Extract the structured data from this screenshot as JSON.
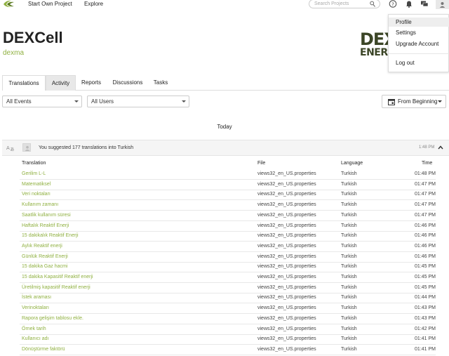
{
  "topbar": {
    "nav": [
      {
        "label": "Start Own Project"
      },
      {
        "label": "Explore"
      }
    ],
    "search_placeholder": "Search Projects"
  },
  "project": {
    "title": "DEXCell",
    "org": "dexma"
  },
  "brand": {
    "line1": "DEX",
    "line2": "ENERGY"
  },
  "account_menu": {
    "items": [
      {
        "label": "Profile"
      },
      {
        "label": "Settings"
      },
      {
        "label": "Upgrade Account"
      },
      {
        "label": "Log out"
      }
    ]
  },
  "tabs": [
    {
      "label": "Translations"
    },
    {
      "label": "Activity"
    },
    {
      "label": "Reports"
    },
    {
      "label": "Discussions"
    },
    {
      "label": "Tasks"
    }
  ],
  "filters": {
    "events": "All Events",
    "users": "All Users",
    "date": "From Beginning"
  },
  "day_label": "Today",
  "activity": {
    "summary": "You suggested 177 translations into Turkish",
    "time": "1:48 PM",
    "columns": {
      "translation": "Translation",
      "file": "File",
      "language": "Language",
      "time": "Time"
    },
    "rows": [
      {
        "translation": "Gerilim L-L",
        "file": "views32_en_US.properties",
        "language": "Turkish",
        "time": "01:48 PM"
      },
      {
        "translation": "Matematiksel",
        "file": "views32_en_US.properties",
        "language": "Turkish",
        "time": "01:47 PM"
      },
      {
        "translation": "Veri noktaları",
        "file": "views32_en_US.properties",
        "language": "Turkish",
        "time": "01:47 PM"
      },
      {
        "translation": "Kullanım zamanı",
        "file": "views32_en_US.properties",
        "language": "Turkish",
        "time": "01:47 PM"
      },
      {
        "translation": "Saatlik kullanım süresi",
        "file": "views32_en_US.properties",
        "language": "Turkish",
        "time": "01:47 PM"
      },
      {
        "translation": "Haftalık Reaktif Enerji",
        "file": "views32_en_US.properties",
        "language": "Turkish",
        "time": "01:46 PM"
      },
      {
        "translation": "15 dakikalık Reaktif Enerji",
        "file": "views32_en_US.properties",
        "language": "Turkish",
        "time": "01:46 PM"
      },
      {
        "translation": "Aylık Reaktif enerji",
        "file": "views32_en_US.properties",
        "language": "Turkish",
        "time": "01:46 PM"
      },
      {
        "translation": "Günlük Reaktif Enerji",
        "file": "views32_en_US.properties",
        "language": "Turkish",
        "time": "01:46 PM"
      },
      {
        "translation": "15 dakika Gaz hacmi",
        "file": "views32_en_US.properties",
        "language": "Turkish",
        "time": "01:45 PM"
      },
      {
        "translation": "15 dakika Kapasitif Reaktif enerji",
        "file": "views32_en_US.properties",
        "language": "Turkish",
        "time": "01:45 PM"
      },
      {
        "translation": "Üretilmiş kapasitif Reaktif enerji",
        "file": "views32_en_US.properties",
        "language": "Turkish",
        "time": "01:45 PM"
      },
      {
        "translation": "İstek araması",
        "file": "views32_en_US.properties",
        "language": "Turkish",
        "time": "01:44 PM"
      },
      {
        "translation": "Verinoktaları",
        "file": "views32_en_US.properties",
        "language": "Turkish",
        "time": "01:43 PM"
      },
      {
        "translation": "Rapora gelişim tablosu ekle.",
        "file": "views32_en_US.properties",
        "language": "Turkish",
        "time": "01:43 PM"
      },
      {
        "translation": "Örnek tarih",
        "file": "views32_en_US.properties",
        "language": "Turkish",
        "time": "01:42 PM"
      },
      {
        "translation": "Kullanıcı adı",
        "file": "views32_en_US.properties",
        "language": "Turkish",
        "time": "01:41 PM"
      },
      {
        "translation": "Dönüştürme faktörü",
        "file": "views32_en_US.properties",
        "language": "Turkish",
        "time": "01:41 PM"
      }
    ]
  },
  "colors": {
    "accent_green": "#8fb040",
    "brand_olive": "#3b4526"
  },
  "icons": [
    "logo-icon",
    "search-icon",
    "help-icon",
    "bell-icon",
    "messages-icon",
    "user-icon",
    "calendar-icon",
    "translate-icon",
    "chevron-up-icon",
    "caret-down-icon"
  ]
}
